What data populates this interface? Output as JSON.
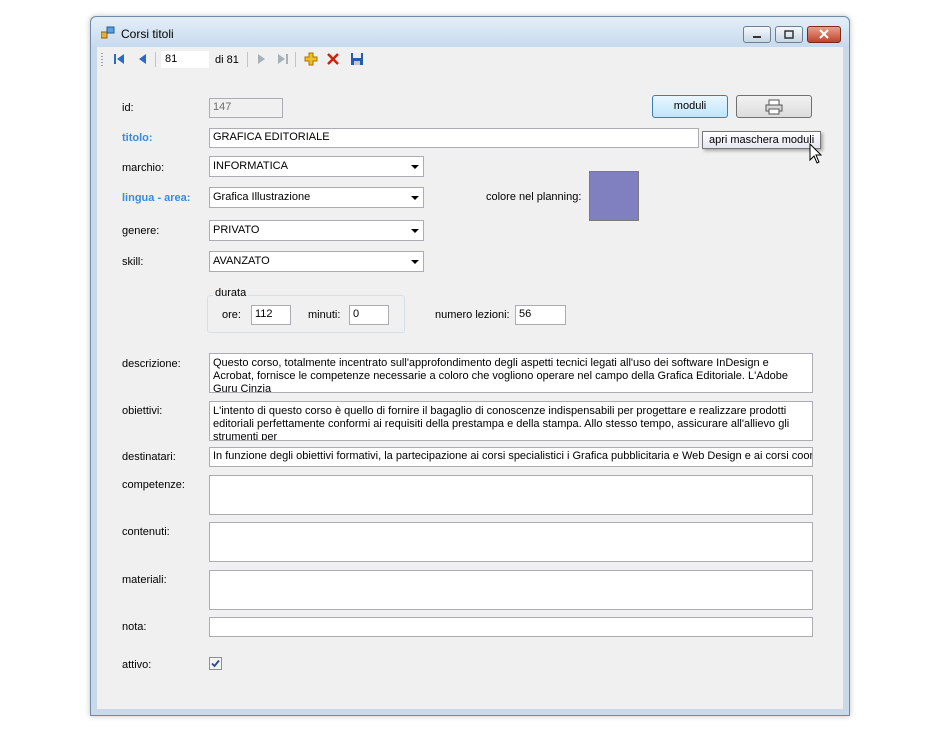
{
  "window": {
    "title": "Corsi titoli"
  },
  "navigator": {
    "position": "81",
    "count_label": "di 81"
  },
  "form": {
    "id": {
      "label": "id:",
      "value": "147"
    },
    "titolo": {
      "label": "titolo:",
      "value": "GRAFICA EDITORIALE"
    },
    "marchio": {
      "label": "marchio:",
      "value": "INFORMATICA"
    },
    "lingua_area": {
      "label": "lingua - area:",
      "value": "Grafica Illustrazione"
    },
    "colore": {
      "label": "colore nel planning:",
      "color": "#8080c0"
    },
    "genere": {
      "label": "genere:",
      "value": "PRIVATO"
    },
    "skill": {
      "label": "skill:",
      "value": "AVANZATO"
    },
    "durata": {
      "group_label": "durata",
      "ore_label": "ore:",
      "ore_value": "112",
      "minuti_label": "minuti:",
      "minuti_value": "0"
    },
    "numero_lezioni": {
      "label": "numero lezioni:",
      "value": "56"
    },
    "descrizione": {
      "label": "descrizione:",
      "value": "Questo corso, totalmente incentrato sull'approfondimento degli aspetti tecnici legati all'uso dei software InDesign e Acrobat, fornisce le competenze necessarie a coloro che vogliono operare nel campo della Grafica Editoriale. L'Adobe Guru Cinzia"
    },
    "obiettivi": {
      "label": "obiettivi:",
      "value": "L'intento di questo corso è quello di fornire il bagaglio di conoscenze indispensabili per progettare e realizzare prodotti editoriali perfettamente conformi ai requisiti della prestampa e della stampa. Allo stesso tempo, assicurare all'allievo gli strumenti per"
    },
    "destinatari": {
      "label": "destinatari:",
      "value": "In funzione degli obiettivi formativi, la partecipazione ai corsi specialistici i Grafica pubblicitaria e Web Design e ai corsi coordinat"
    },
    "competenze": {
      "label": "competenze:",
      "value": ""
    },
    "contenuti": {
      "label": "contenuti:",
      "value": ""
    },
    "materiali": {
      "label": "materiali:",
      "value": ""
    },
    "nota": {
      "label": "nota:",
      "value": ""
    },
    "attivo": {
      "label": "attivo:",
      "checked": true
    }
  },
  "buttons": {
    "moduli_label": "moduli",
    "print_icon": "printer-icon"
  },
  "tooltip": {
    "text": "apri maschera moduli"
  },
  "colors": {
    "label_accent": "#3c8ad8",
    "swatch": "#8080c0"
  }
}
